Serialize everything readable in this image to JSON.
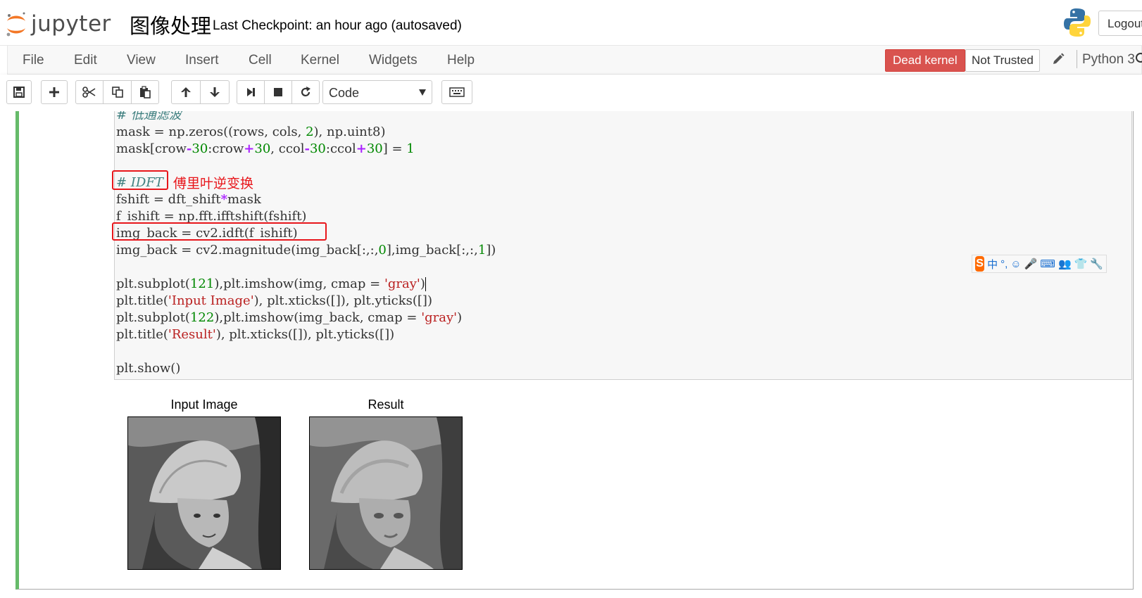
{
  "header": {
    "logo_text": "jupyter",
    "notebook_name": "图像处理",
    "checkpoint": "Last Checkpoint: an hour ago (autosaved)",
    "logout_label": "Logout"
  },
  "menubar": {
    "items": [
      {
        "label": "File"
      },
      {
        "label": "Edit"
      },
      {
        "label": "View"
      },
      {
        "label": "Insert"
      },
      {
        "label": "Cell"
      },
      {
        "label": "Kernel"
      },
      {
        "label": "Widgets"
      },
      {
        "label": "Help"
      }
    ],
    "kernel_status": "Dead kernel",
    "trust_status": "Not Trusted",
    "kernel_name": "Python 3"
  },
  "toolbar": {
    "cell_type": "Code",
    "buttons": [
      "save-icon",
      "plus-icon",
      "cut-icon",
      "copy-icon",
      "paste-icon",
      "arrow-up-icon",
      "arrow-down-icon",
      "run-icon",
      "stop-icon",
      "restart-icon",
      "keyboard-icon"
    ]
  },
  "cell": {
    "code_lines": [
      "# 低通滤波",
      "mask = np.zeros((rows, cols, 2), np.uint8)",
      "mask[crow-30:crow+30, ccol-30:ccol+30] = 1",
      "",
      "# IDFT",
      "fshift = dft_shift*mask",
      "f_ishift = np.fft.ifftshift(fshift)",
      "img_back = cv2.idft(f_ishift)",
      "img_back = cv2.magnitude(img_back[:,:,0],img_back[:,:,1])",
      "",
      "plt.subplot(121),plt.imshow(img, cmap = 'gray')",
      "plt.title('Input Image'), plt.xticks([]), plt.yticks([])",
      "plt.subplot(122),plt.imshow(img_back, cmap = 'gray')",
      "plt.title('Result'), plt.xticks([]), plt.yticks([])",
      "",
      "plt.show()"
    ],
    "annotation": "傅里叶逆变换",
    "output": {
      "titles": [
        "Input Image",
        "Result"
      ]
    }
  },
  "ime_toolbar": {
    "logo": "S",
    "items": [
      "中",
      "°,",
      "☺",
      "🎤",
      "⌨",
      "👥",
      "👕",
      "🔧"
    ]
  },
  "colors": {
    "dead_kernel": "#d9534f",
    "cell_border_active": "#66bb6a",
    "annotation_red": "#e8161b"
  }
}
